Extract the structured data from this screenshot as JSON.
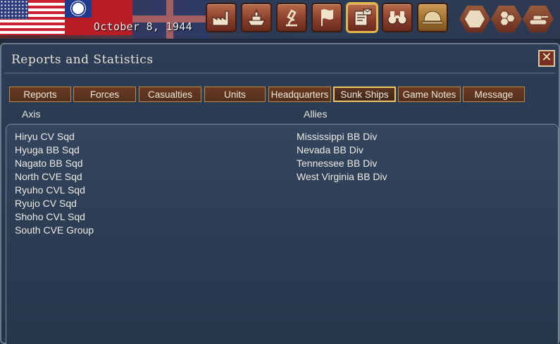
{
  "header": {
    "date": "October 8, 1944",
    "flags": [
      "us-flag",
      "roc-flag",
      "uk-flag"
    ],
    "toolbar": [
      {
        "name": "production-button",
        "icon": "factory-icon"
      },
      {
        "name": "naval-button",
        "icon": "ship-icon"
      },
      {
        "name": "research-button",
        "icon": "microscope-icon"
      },
      {
        "name": "objectives-button",
        "icon": "flag-icon"
      },
      {
        "name": "reports-button",
        "icon": "report-icon",
        "active": true
      },
      {
        "name": "intelligence-button",
        "icon": "binoculars-icon"
      },
      {
        "name": "army-button",
        "icon": "helmet-icon"
      }
    ]
  },
  "panel": {
    "title": "Reports and Statistics",
    "close_symbol": "✕",
    "tabs": [
      {
        "label": "Reports"
      },
      {
        "label": "Forces"
      },
      {
        "label": "Casualties"
      },
      {
        "label": "Units"
      },
      {
        "label": "Headquarters"
      },
      {
        "label": "Sunk Ships",
        "active": true
      },
      {
        "label": "Game Notes"
      },
      {
        "label": "Message"
      }
    ],
    "columns": {
      "axis": "Axis",
      "allies": "Allies"
    },
    "axis_ships": [
      "Hiryu CV Sqd",
      "Hyuga BB Sqd",
      "Nagato BB Sqd",
      "North CVE Sqd",
      "Ryuho CVL Sqd",
      "Ryujo CV Sqd",
      "Shoho CVL Sqd",
      "South CVE Group"
    ],
    "allied_ships": [
      "Mississippi BB Div",
      "Nevada BB Div",
      "Tennessee BB Div",
      "West Virginia BB Div"
    ]
  },
  "colors": {
    "tab_active_border": "#f0c766",
    "panel_bg": "#2c3d55",
    "button_brown": "#8a3f2c"
  }
}
